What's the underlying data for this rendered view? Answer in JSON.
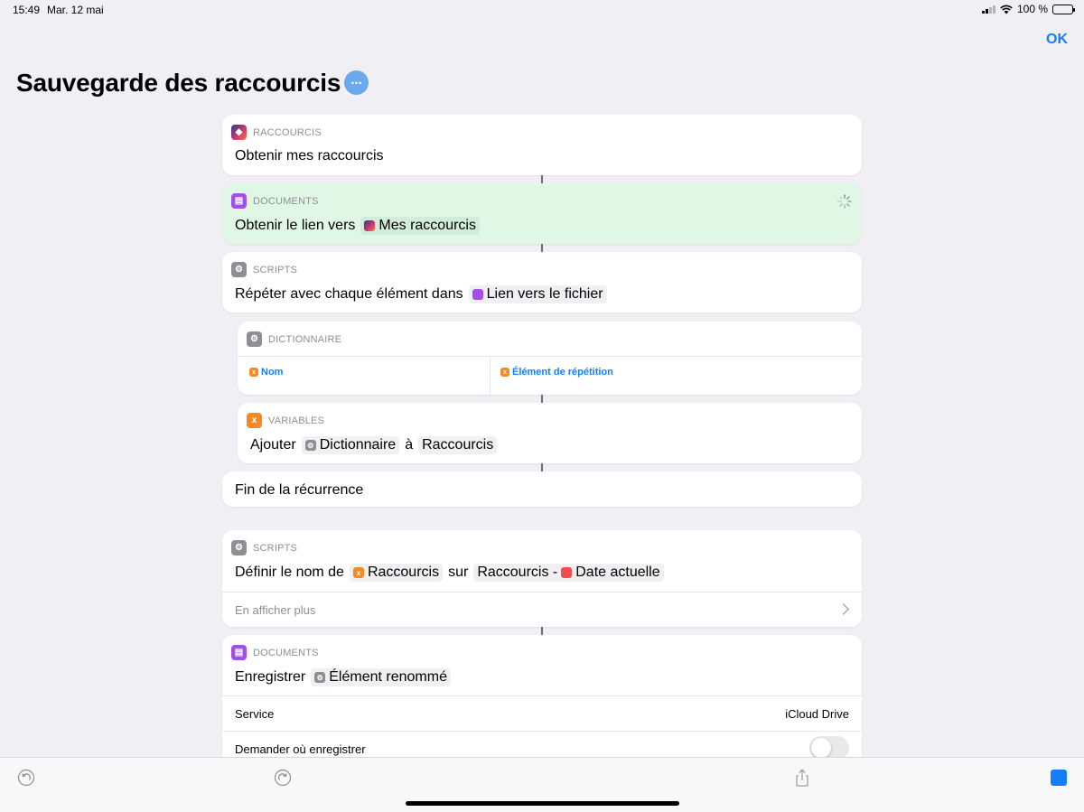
{
  "status_bar": {
    "time": "15:49",
    "date": "Mar. 12 mai",
    "battery": "100 %"
  },
  "header": {
    "done_label": "OK",
    "title": "Sauvegarde des raccourcis",
    "more_icon": "ellipsis-icon"
  },
  "actions": {
    "get_shortcuts": {
      "category": "RACCOURCIS",
      "text": "Obtenir mes raccourcis"
    },
    "get_link": {
      "category": "DOCUMENTS",
      "text": "Obtenir le lien vers",
      "token": "Mes raccourcis"
    },
    "repeat": {
      "category": "SCRIPTS",
      "text": "Répéter avec chaque élément dans",
      "token": "Lien vers le fichier"
    },
    "dictionary": {
      "category": "DICTIONNAIRE",
      "key": "Nom",
      "value": "Élément de répétition"
    },
    "add_variable": {
      "category": "VARIABLES",
      "text_before": "Ajouter",
      "token_1": "Dictionnaire",
      "text_mid": "à",
      "token_2": "Raccourcis"
    },
    "end_repeat": {
      "text": "Fin de la récurrence"
    },
    "rename": {
      "category": "SCRIPTS",
      "text_before": "Définir le nom de",
      "token_1": "Raccourcis",
      "text_mid": "sur",
      "token_2_prefix": "Raccourcis -",
      "token_2_var": "Date actuelle",
      "more_label": "En afficher plus"
    },
    "save_file": {
      "category": "DOCUMENTS",
      "text_before": "Enregistrer",
      "token": "Élément renommé",
      "service_label": "Service",
      "service_value": "iCloud Drive",
      "ask_label": "Demander où enregistrer",
      "ask_toggle_on": false
    }
  },
  "toolbar": {
    "undo_icon": "undo-icon",
    "redo_icon": "redo-icon",
    "share_icon": "share-icon",
    "run_icon": "stop-icon"
  },
  "colors": {
    "accent": "#147efb",
    "running_bg": "#e1f7e6",
    "documents": "#a44fe8",
    "variables": "#f48a23",
    "scripts": "#8e8e93",
    "date": "#ef4d4d"
  }
}
